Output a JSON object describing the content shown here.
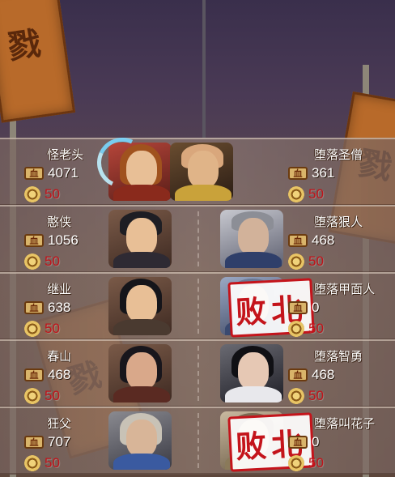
{
  "scene": {
    "banner_glyph": "戮",
    "colors": {
      "row_bg": "#8e7468",
      "level_red": "#c0131a",
      "defeat_red": "#c4141b",
      "banner": "#b86a2a"
    }
  },
  "rows": [
    {
      "left": {
        "name": "怪老头",
        "hp": "4071",
        "level": "50",
        "portrait": "long-haired-swordsman"
      },
      "right": {
        "name": "堕落圣僧",
        "hp": "361",
        "level": "50",
        "portrait": "bald-monk"
      }
    },
    {
      "left": {
        "name": "憨侠",
        "hp": "1056",
        "level": "50",
        "portrait": "black-haired-swordsman"
      },
      "right": {
        "name": "堕落狠人",
        "hp": "468",
        "level": "50",
        "portrait": "scarred-warrior"
      }
    },
    {
      "left": {
        "name": "继业",
        "hp": "638",
        "level": "50",
        "portrait": "young-swordsman"
      },
      "right": {
        "name": "堕落甲面人",
        "hp": "0",
        "level": "50",
        "defeated": "败北",
        "portrait": "masked-fighter"
      }
    },
    {
      "left": {
        "name": "春山",
        "hp": "468",
        "level": "50",
        "portrait": "female-warrior"
      },
      "right": {
        "name": "堕落智勇",
        "hp": "468",
        "level": "50",
        "portrait": "blindfolded-swordsman"
      }
    },
    {
      "left": {
        "name": "狂父",
        "hp": "707",
        "level": "50",
        "portrait": "grey-haired-elder"
      },
      "right": {
        "name": "堕落叫花子",
        "hp": "0",
        "level": "50",
        "defeated": "败北",
        "portrait": "beggar"
      }
    }
  ],
  "icons": {
    "hp": "blood-icon",
    "hp_glyph": "血",
    "level": "level-medal-icon"
  }
}
